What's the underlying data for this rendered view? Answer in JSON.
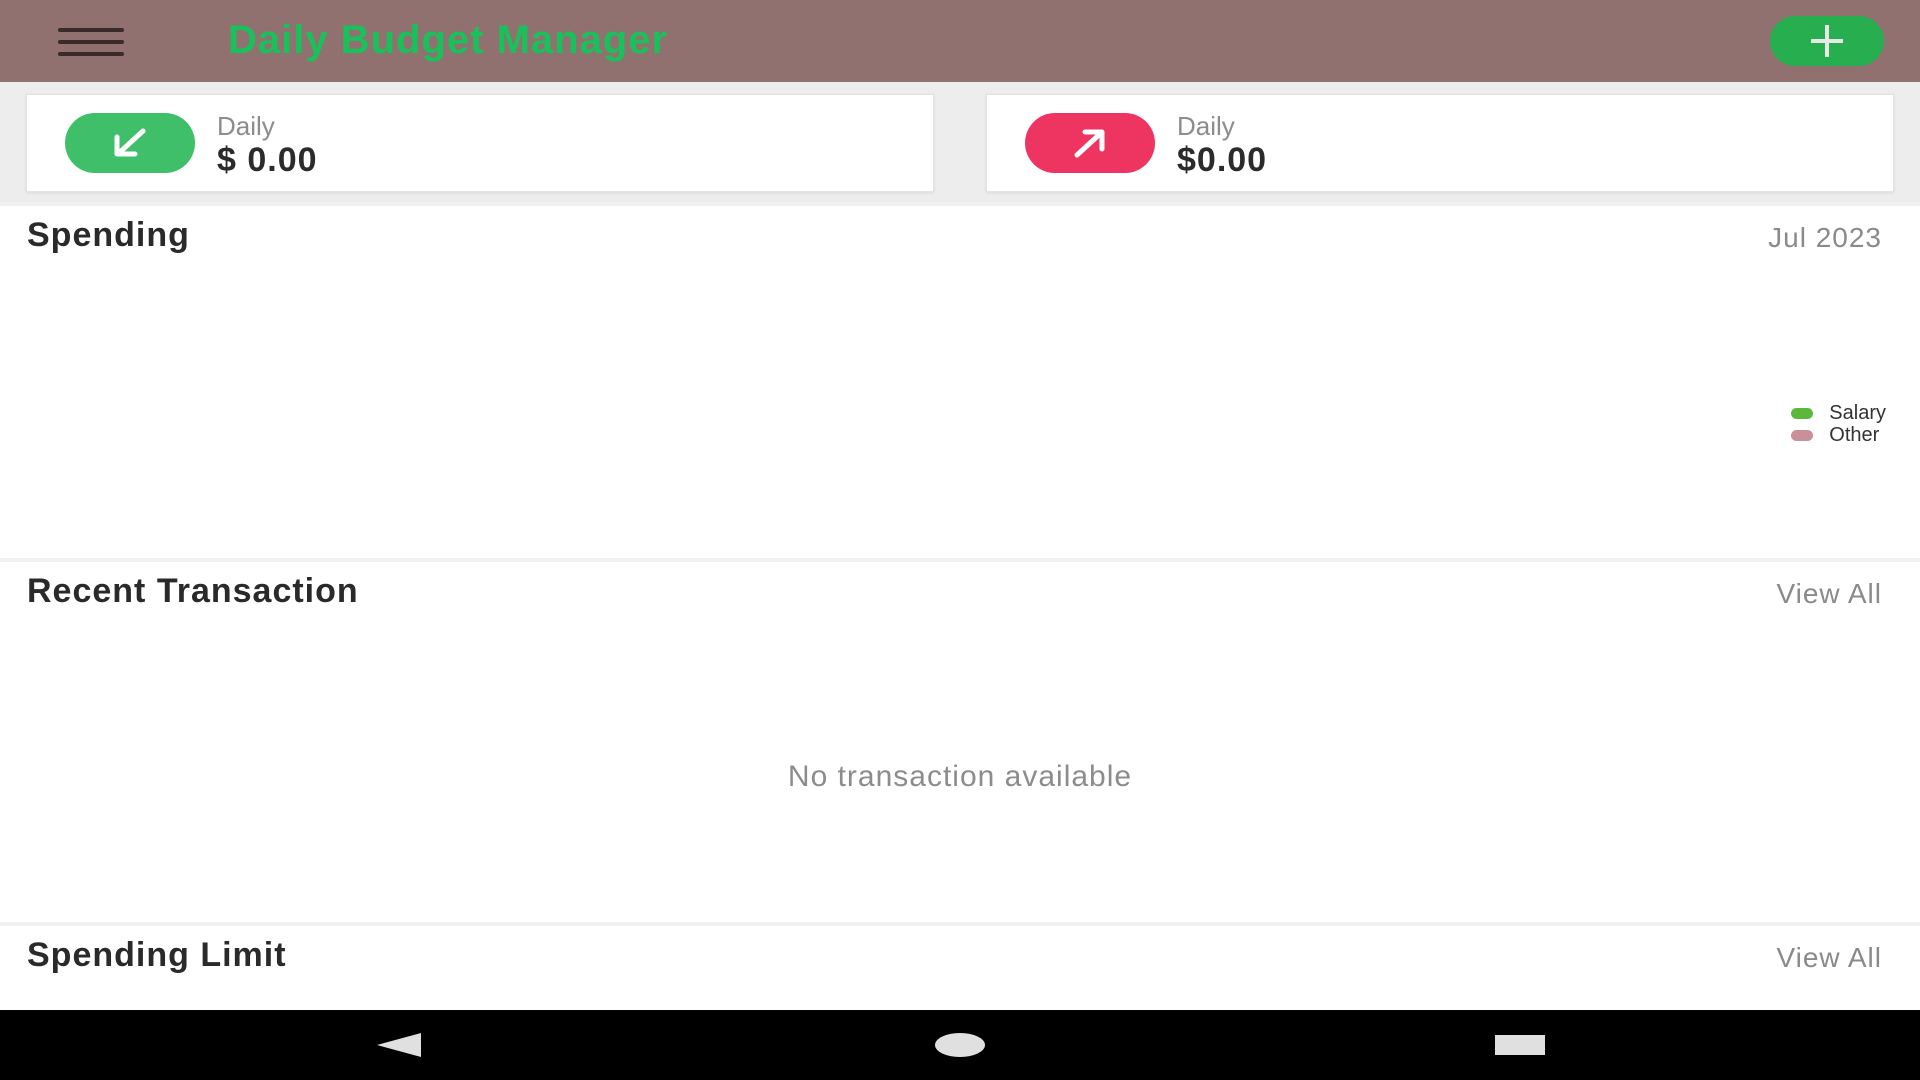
{
  "app_bar": {
    "title": "Daily Budget Manager",
    "menu_icon": "hamburger-menu-icon",
    "add_icon": "plus-icon",
    "background_color": "#917070",
    "title_color": "#19c15a",
    "add_button_color": "#27ae4f"
  },
  "summary": {
    "income": {
      "label": "Daily",
      "amount": "$ 0.00",
      "icon": "arrow-down-left-icon",
      "color": "#3fbf6a"
    },
    "expense": {
      "label": "Daily",
      "amount": "$0.00",
      "icon": "arrow-up-right-icon",
      "color": "#ee3562"
    }
  },
  "spending": {
    "title": "Spending",
    "period": "Jul 2023",
    "legend": [
      {
        "name": "Salary",
        "color": "#5cb83c"
      },
      {
        "name": "Other",
        "color": "#c98f9b"
      }
    ]
  },
  "recent": {
    "title": "Recent Transaction",
    "view_all": "View All",
    "empty": "No transaction available"
  },
  "limit": {
    "title": "Spending Limit",
    "view_all": "View All"
  },
  "nav_bar": {
    "back_icon": "back-triangle-icon",
    "home_icon": "home-circle-icon",
    "recent_icon": "recent-apps-square-icon"
  }
}
